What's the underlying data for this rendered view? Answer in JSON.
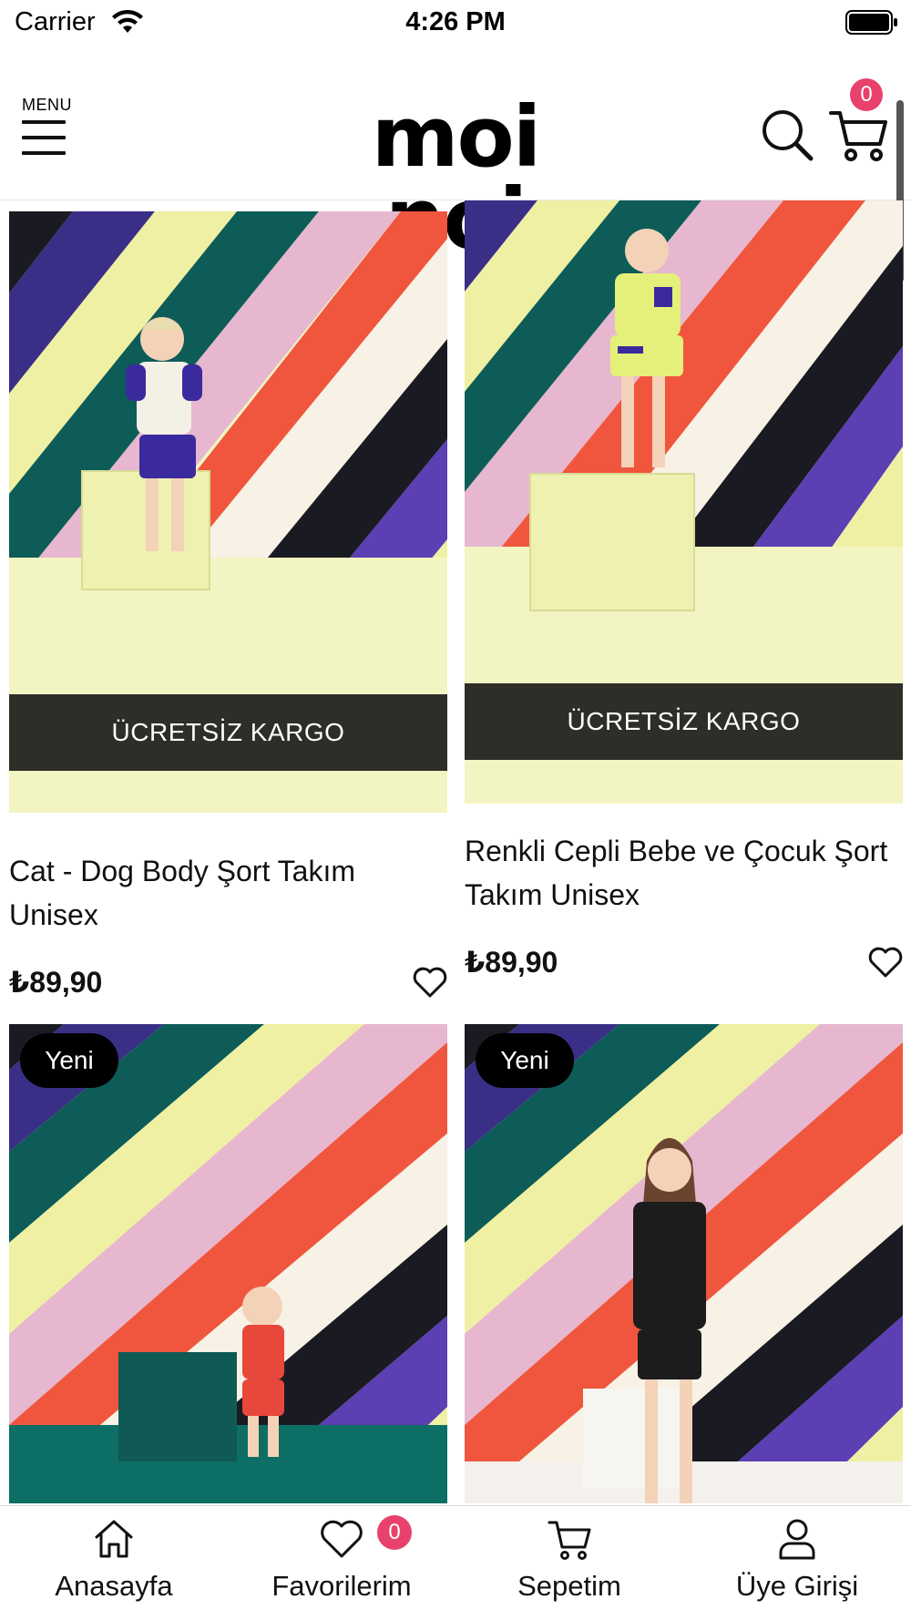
{
  "status_bar": {
    "carrier": "Carrier",
    "time": "4:26 PM"
  },
  "header": {
    "menu_label": "MENU",
    "logo_text": "moi noi",
    "cart_count": "0"
  },
  "products": [
    {
      "title": "Cat - Dog Body Şort Takım Unisex",
      "price": "₺89,90",
      "banner": "ÜCRETSİZ KARGO",
      "badge": ""
    },
    {
      "title": "Renkli Cepli Bebe ve Çocuk Şort Takım Unisex",
      "price": "₺89,90",
      "banner": "ÜCRETSİZ KARGO",
      "badge": ""
    },
    {
      "title": "",
      "price": "",
      "banner": "",
      "badge": "Yeni"
    },
    {
      "title": "",
      "price": "",
      "banner": "",
      "badge": "Yeni"
    }
  ],
  "tabbar": {
    "tabs": [
      {
        "label": "Anasayfa",
        "icon": "home-icon"
      },
      {
        "label": "Favorilerim",
        "icon": "heart-icon"
      },
      {
        "label": "Sepetim",
        "icon": "cart-icon"
      },
      {
        "label": "Üye Girişi",
        "icon": "user-icon"
      }
    ],
    "favorites_count": "0"
  },
  "colors": {
    "accent_badge": "#e8416b",
    "banner_bg": "#2e2d28",
    "stripe_navy": "#3a2f86",
    "stripe_teal": "#0d5c57",
    "stripe_yellow": "#eff0a3",
    "stripe_pink": "#e7b7cf",
    "stripe_red": "#f0563d",
    "stripe_cream": "#f7f1e6",
    "stripe_black": "#1a1a22",
    "stripe_purple": "#5b3fb3"
  }
}
